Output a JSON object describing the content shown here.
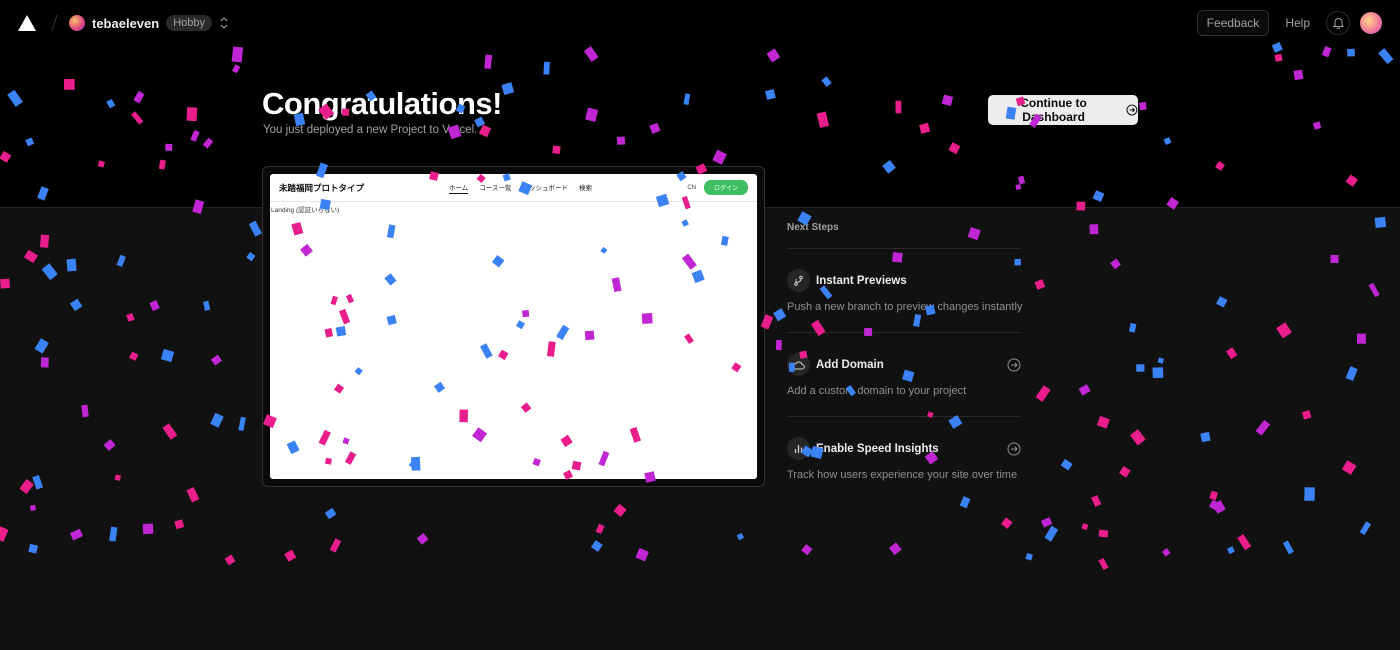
{
  "header": {
    "team_name": "tebaeleven",
    "plan": "Hobby",
    "feedback_label": "Feedback",
    "help_label": "Help",
    "icons": {
      "logo": "vercel-triangle-icon",
      "switcher": "chevron-up-down-icon",
      "notifications": "bell-icon"
    }
  },
  "hero": {
    "title": "Congratulations!",
    "subtitle": "You just deployed a new Project to Vercel.",
    "continue_label": "Continue to Dashboard"
  },
  "preview": {
    "site_title": "未踏福岡プロトタイプ",
    "nav_links": [
      "ホーム",
      "コース一覧",
      "ダッシュボード",
      "検索"
    ],
    "lang": "CN",
    "login_label": "ログイン",
    "body_text": "Landing (認証いらない)"
  },
  "next_steps": {
    "title": "Next Steps",
    "items": [
      {
        "title": "Instant Previews",
        "description": "Push a new branch to preview changes instantly",
        "icon": "git-branch-icon",
        "has_arrow": false
      },
      {
        "title": "Add Domain",
        "description": "Add a custom domain to your project",
        "icon": "cloud-icon",
        "has_arrow": true
      },
      {
        "title": "Enable Speed Insights",
        "description": "Track how users experience your site over time",
        "icon": "bar-chart-icon",
        "has_arrow": true
      }
    ]
  },
  "colors": {
    "confetti": [
      "#3b82f6",
      "#e91e8c",
      "#c026d3"
    ],
    "accent_green": "#3fbf5f",
    "background_top": "#000000",
    "background_bottom": "#111111"
  }
}
